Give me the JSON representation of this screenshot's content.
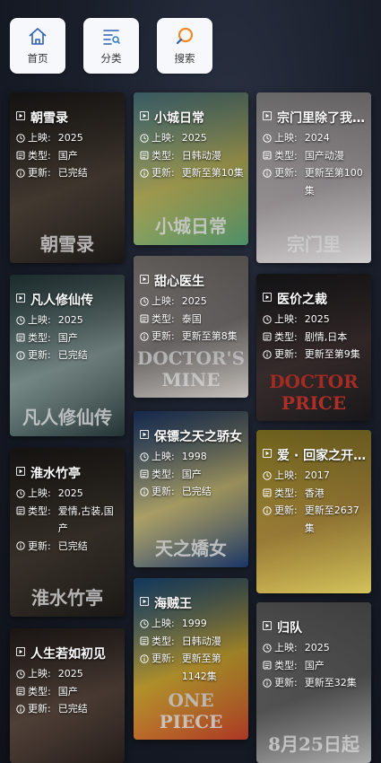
{
  "nav": [
    {
      "label": "首页",
      "icon": "home-icon"
    },
    {
      "label": "分类",
      "icon": "category-icon"
    },
    {
      "label": "搜索",
      "icon": "search-icon"
    }
  ],
  "labels": {
    "release": "上映:",
    "type": "类型:",
    "update": "更新:"
  },
  "cards": [
    {
      "title": "朝雪录",
      "year": "2025",
      "type": "国产",
      "update": "已完结",
      "poster_text": "朝雪录",
      "colors": [
        "#2d2a26",
        "#5b4e42",
        "#1c1a18"
      ]
    },
    {
      "title": "凡人修仙传",
      "year": "2025",
      "type": "国产",
      "update": "已完结",
      "poster_text": "凡人修仙传",
      "colors": [
        "#3c5d60",
        "#9fb8b4",
        "#2a3c3e"
      ]
    },
    {
      "title": "淮水竹亭",
      "year": "2025",
      "type": "爱情,古装,国产",
      "update": "已完结",
      "poster_text": "淮水竹亭",
      "colors": [
        "#2e2a25",
        "#4a4137",
        "#1e1b18"
      ]
    },
    {
      "title": "人生若如初见",
      "year": "2025",
      "type": "国产",
      "update": "已完结",
      "poster_text": "",
      "colors": [
        "#3a2f2c",
        "#6a564a",
        "#2a201d"
      ]
    },
    {
      "title": "小城日常",
      "year": "2025",
      "type": "日韩动漫",
      "update": "更新至第10集",
      "poster_text": "小城日常",
      "colors": [
        "#7ec8d8",
        "#d8d06a",
        "#5aa87a"
      ]
    },
    {
      "title": "甜心医生",
      "year": "2025",
      "type": "泰国",
      "update": "更新至第8集",
      "poster_text": "DOCTOR'S MINE",
      "colors": [
        "#cfc7c0",
        "#8f8a88",
        "#e8e2dc"
      ]
    },
    {
      "title": "保镖之天之骄女",
      "year": "1998",
      "type": "国产",
      "update": "已完结",
      "poster_text": "天之嬌女",
      "colors": [
        "#2d5aa8",
        "#e8d98a",
        "#1d3d78"
      ]
    },
    {
      "title": "海贼王",
      "year": "1999",
      "type": "日韩动漫",
      "update": "更新至第1142集",
      "poster_text": "ONE PIECE",
      "colors": [
        "#2b7bc9",
        "#f0c43a",
        "#c9402b"
      ]
    },
    {
      "title": "宗门里除了我…",
      "year": "2024",
      "type": "国产动漫",
      "update": "更新至第100集",
      "poster_text": "宗门里",
      "colors": [
        "#e8e6e6",
        "#c8c0c4",
        "#f4f2f2"
      ]
    },
    {
      "title": "医价之裁",
      "year": "2025",
      "type": "剧情,日本",
      "update": "更新至第9集",
      "poster_text": "DOCTOR PRICE",
      "colors": [
        "#2a2a2e",
        "#4a3a3a",
        "#1a1a1d"
      ]
    },
    {
      "title": "爱 · 回家之开…",
      "year": "2017",
      "type": "香港",
      "update": "更新至2637集",
      "poster_text": "",
      "colors": [
        "#f2d641",
        "#d0a84a",
        "#f7e56a"
      ]
    },
    {
      "title": "归队",
      "year": "2025",
      "type": "国产",
      "update": "更新至32集",
      "poster_text": "8月25日起",
      "colors": [
        "#9a9a9a",
        "#6f6f6f",
        "#c9c9c9"
      ]
    }
  ]
}
